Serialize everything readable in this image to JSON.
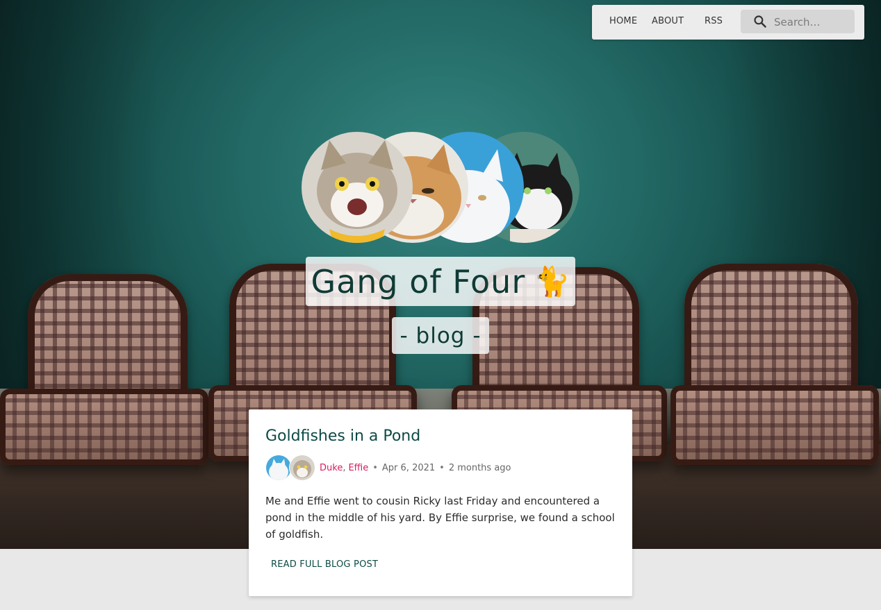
{
  "nav": {
    "items": [
      {
        "label": "HOME"
      },
      {
        "label": "ABOUT"
      },
      {
        "label": "RSS"
      }
    ],
    "search": {
      "placeholder": "Search…",
      "icon": "search-icon"
    }
  },
  "hero": {
    "avatars": [
      {
        "name": "cat-avatar-tabby",
        "icon": "cat-photo"
      },
      {
        "name": "cat-avatar-grumpy",
        "icon": "cat-photo"
      },
      {
        "name": "cat-avatar-white",
        "icon": "cat-photo"
      },
      {
        "name": "cat-avatar-tuxedo",
        "icon": "cat-photo"
      }
    ],
    "title": "Gang of Four",
    "title_emoji": "🐈",
    "subtitle": "- blog -"
  },
  "post": {
    "title": "Goldfishes in a Pond",
    "authors": [
      "Duke",
      "Effie"
    ],
    "author_separator": ",",
    "date": "Apr 6, 2021",
    "relative_time": "2 months ago",
    "bullet": "•",
    "excerpt": "Me and Effie went to cousin Ricky last Friday and encountered a pond in the middle of his yard. By Effie surprise, we found a school of goldfish.",
    "read_more": "READ FULL BLOG POST"
  },
  "colors": {
    "accent": "#d81b60",
    "title_teal": "#0d4a45",
    "nav_bg": "#ececec",
    "page_bg": "#e8e8e8"
  }
}
